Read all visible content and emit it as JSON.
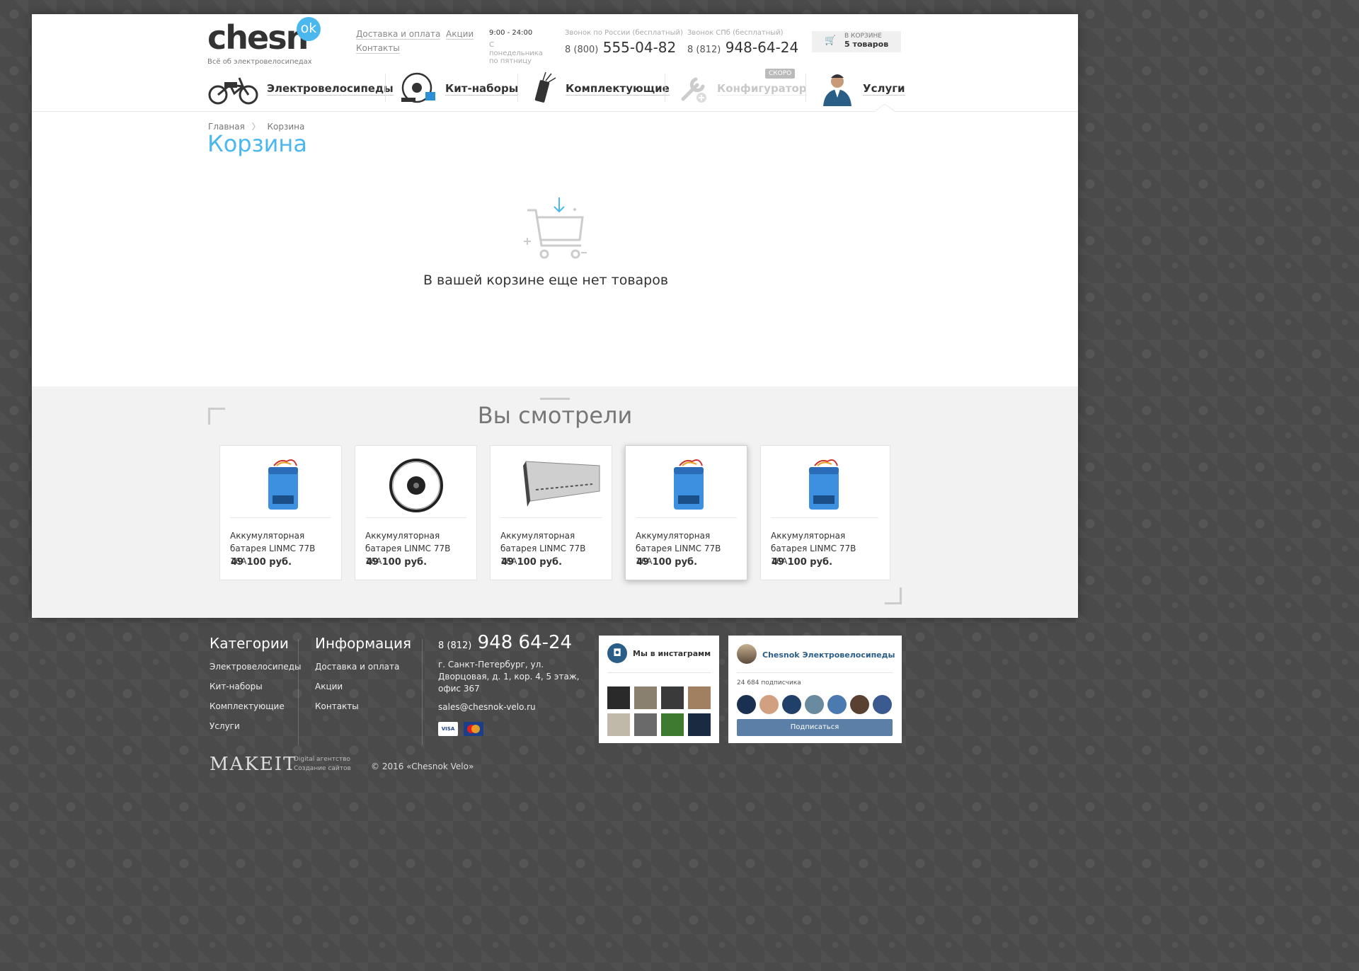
{
  "header": {
    "logo_text": "chesn",
    "logo_badge": "ok",
    "tagline": "Всё об электровелосипедах",
    "links": [
      "Доставка и оплата",
      "Контакты",
      "Акции"
    ],
    "hours": "9:00 - 24:00",
    "hours_note": "С понедельника по пятницу",
    "phone_ru": {
      "caption": "Звонок по России (бесплатный)",
      "prefix": "8 (800)",
      "number": "555-04-82"
    },
    "phone_spb": {
      "caption": "Звонок СПб (бесплатный)",
      "prefix": "8 (812)",
      "number": "948-64-24"
    },
    "cart": {
      "label": "В КОРЗИНЕ",
      "count": "5 товаров"
    }
  },
  "nav": {
    "items": [
      "Электровелосипеды",
      "Кит-наборы",
      "Комплектующие",
      "Конфигуратор",
      "Услуги"
    ],
    "badge_soon": "СКОРО"
  },
  "breadcrumb": [
    "Главная",
    "Корзина"
  ],
  "page_title": "Корзина",
  "empty_message": "В вашей корзине еще нет товаров",
  "viewed": {
    "title": "Вы смотрели",
    "products": [
      {
        "name": "Аккумуляторная батарея LINMC 77В 16А",
        "price": "49 100 руб.",
        "image": "battery"
      },
      {
        "name": "Аккумуляторная батарея LINMC 77В 16А",
        "price": "49 100 руб.",
        "image": "wheel"
      },
      {
        "name": "Аккумуляторная батарея LINMC 77В 16А",
        "price": "49 100 руб.",
        "image": "controller"
      },
      {
        "name": "Аккумуляторная батарея LINMC 77В 16А",
        "price": "49 100 руб.",
        "image": "battery"
      },
      {
        "name": "Аккумуляторная батарея LINMC 77В 16А",
        "price": "49 100 руб.",
        "image": "battery"
      }
    ]
  },
  "footer": {
    "categories_title": "Категории",
    "categories": [
      "Электровелосипеды",
      "Кит-наборы",
      "Комплектующие",
      "Услуги"
    ],
    "info_title": "Информация",
    "info": [
      "Доставка и оплата",
      "Акции",
      "Контакты"
    ],
    "phone_prefix": "8 (812)",
    "phone_number": "948 64-24",
    "address": "г. Санкт-Петербург, ул. Дворцовая, д. 1, кор. 4, 5 этаж, офис 367",
    "email": "sales@chesnok-velo.ru",
    "payment": [
      "VISA",
      "MasterCard"
    ],
    "instagram_title": "Мы в инстаграмм",
    "vk_name": "Chesnok Электровелосипеды",
    "vk_subscribers": "24 684 подписчика",
    "vk_subscribe": "Подписаться",
    "makeit": "MAKEIT",
    "makeit_sub1": "Digital агентство",
    "makeit_sub2": "Создание сайтов",
    "copyright": "© 2016 «Chesnok Velo»"
  },
  "colors": {
    "accent": "#4ab8ef",
    "vk": "#5b7fa6",
    "dark_bg": "#4a4a4a"
  }
}
